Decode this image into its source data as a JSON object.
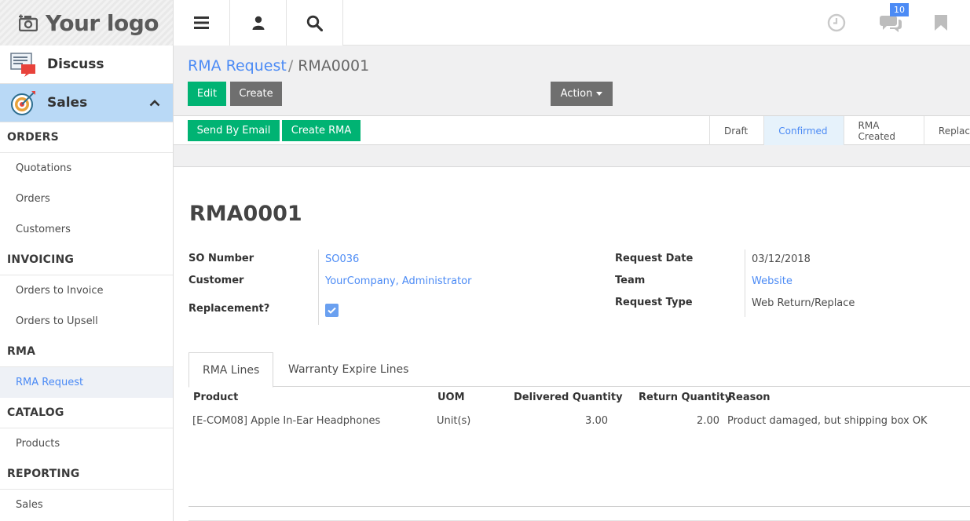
{
  "topbar": {
    "logo_text": "Your logo",
    "messages_badge": "10"
  },
  "sidebar": {
    "apps": [
      {
        "label": "Discuss"
      },
      {
        "label": "Sales"
      }
    ],
    "sections": {
      "orders": "ORDERS",
      "invoicing": "INVOICING",
      "rma": "RMA",
      "catalog": "CATALOG",
      "reporting": "REPORTING"
    },
    "items": {
      "quotations": "Quotations",
      "orders": "Orders",
      "customers": "Customers",
      "orders_to_invoice": "Orders to Invoice",
      "orders_to_upsell": "Orders to Upsell",
      "rma_request": "RMA Request",
      "products": "Products",
      "sales": "Sales"
    }
  },
  "breadcrumb": {
    "parent": "RMA Request",
    "separator": "/",
    "current": "RMA0001"
  },
  "buttons": {
    "edit": "Edit",
    "create": "Create",
    "action": "Action",
    "send_by_email": "Send By Email",
    "create_rma": "Create RMA"
  },
  "stages": [
    "Draft",
    "Confirmed",
    "RMA Created",
    "Replac"
  ],
  "active_stage": "Confirmed",
  "record": {
    "title": "RMA0001",
    "so_number_label": "SO Number",
    "so_number": "SO036",
    "customer_label": "Customer",
    "customer": "YourCompany, Administrator",
    "replacement_label": "Replacement?",
    "replacement": true,
    "request_date_label": "Request Date",
    "request_date": "03/12/2018",
    "team_label": "Team",
    "team": "Website",
    "request_type_label": "Request Type",
    "request_type": "Web Return/Replace"
  },
  "tabs": [
    "RMA Lines",
    "Warranty Expire Lines"
  ],
  "table": {
    "headers": {
      "product": "Product",
      "uom": "UOM",
      "delivered": "Delivered Quantity",
      "returned": "Return Quantity",
      "reason": "Reason"
    },
    "rows": [
      {
        "product": "[E-COM08] Apple In-Ear Headphones",
        "uom": "Unit(s)",
        "delivered": "3.00",
        "returned": "2.00",
        "reason": "Product damaged, but shipping box OK"
      }
    ]
  },
  "colors": {
    "accent": "#4c8bf5",
    "primary_button": "#00b373",
    "secondary_button": "#6f6f6f",
    "active_app": "#b9d9f6"
  }
}
